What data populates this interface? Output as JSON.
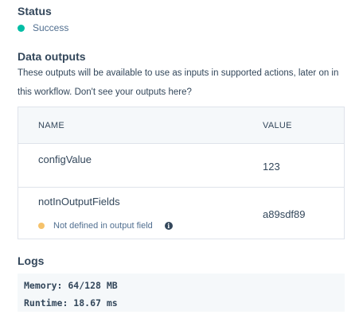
{
  "status": {
    "heading": "Status",
    "value": "Success",
    "color": "#00bda5"
  },
  "data_outputs": {
    "heading": "Data outputs",
    "description": "These outputs will be available to use as inputs in supported actions, later on in this workflow. Don't see your outputs here?",
    "columns": {
      "name": "NAME",
      "value": "VALUE"
    },
    "rows": [
      {
        "name": "configValue",
        "value": "123"
      },
      {
        "name": "notInOutputFields",
        "value": "a89sdf89",
        "warning": "Not defined in output field",
        "warning_color": "#f5c26b",
        "warning_icon": "info-icon"
      }
    ]
  },
  "logs": {
    "heading": "Logs",
    "lines": [
      "Memory: 64/128 MB",
      "Runtime: 18.67 ms"
    ]
  }
}
